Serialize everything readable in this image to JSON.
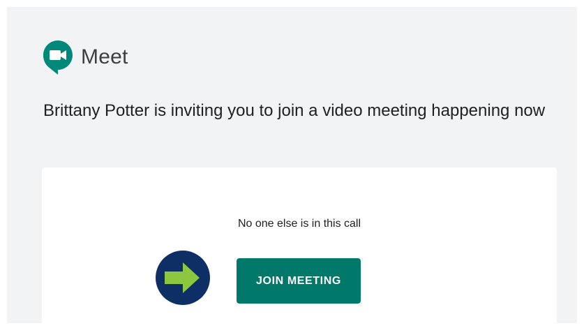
{
  "app": {
    "name": "Meet",
    "logo_icon": "google-meet-logo-icon",
    "brand_color": "#00897b"
  },
  "invitation": {
    "message": "Brittany Potter is inviting you to join a video meeting happening now"
  },
  "call_card": {
    "status_text": "No one else is in this call",
    "join_button_label": "JOIN MEETING",
    "join_button_color": "#00796b"
  },
  "annotation": {
    "icon": "arrow-right-icon",
    "circle_color": "#0d2f66",
    "arrow_color": "#8dc63f"
  }
}
